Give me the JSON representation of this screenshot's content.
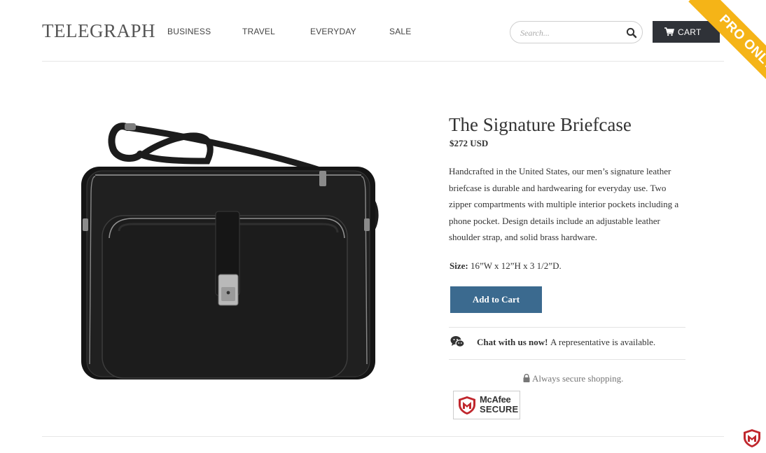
{
  "header": {
    "logo": "TELEGRAPH",
    "nav": [
      "BUSINESS",
      "TRAVEL",
      "EVERYDAY",
      "SALE"
    ],
    "search_placeholder": "Search...",
    "cart_label": "CART",
    "ribbon": "PRO ONLY"
  },
  "product": {
    "title": "The Signature Briefcase",
    "price": "$272 USD",
    "description": "Handcrafted in the United States, our men’s signature leather briefcase is durable and hardwearing for everyday use. Two zipper compartments with multiple interior pockets including a phone pocket. Design details include an adjustable leather shoulder strap, and solid brass hardware.",
    "size_label": "Size:",
    "size_value": "16”W x 12”H x 3 1/2”D.",
    "add_to_cart": "Add to Cart",
    "chat_bold": "Chat with us now!",
    "chat_rest": "A representative is available.",
    "secure_text": "Always secure shopping.",
    "badge_line1": "McAfee",
    "badge_line2": "SECURE"
  },
  "colors": {
    "accent": "#3b6a8f",
    "cart_bg": "#2f3238",
    "ribbon": "#f5b417",
    "badge_red": "#c0272d"
  },
  "icons": {
    "search": "search-icon",
    "cart": "cart-icon",
    "chat": "chat-icon",
    "lock": "lock-icon",
    "shield": "mcafee-shield-icon"
  }
}
